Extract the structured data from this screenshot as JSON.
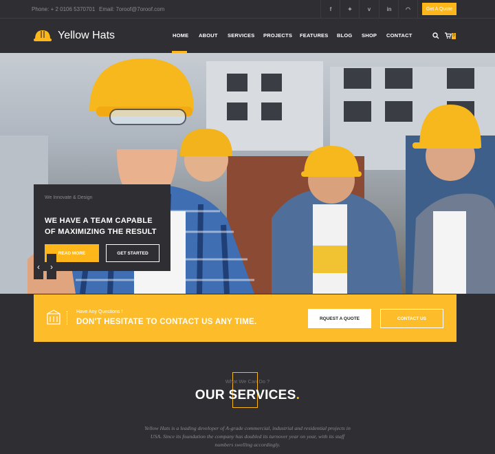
{
  "topbar": {
    "phone": "Phone: + 2 0106 5370701",
    "email": "Email: 7oroof@7oroof.com",
    "social": [
      "facebook-icon",
      "twitter-icon",
      "vimeo-icon",
      "linkedin-icon",
      "rss-icon"
    ],
    "social_glyphs": [
      "f",
      "✦",
      "v",
      "in",
      "◠"
    ],
    "quote_label": "Get A Quote"
  },
  "brand": {
    "name": "Yellow Hats",
    "accent": "#fdb71a"
  },
  "nav": {
    "items": [
      "HOME",
      "ABOUT",
      "SERVICES",
      "PROJECTS",
      "FEATURES",
      "BLOG",
      "SHOP",
      "CONTACT"
    ],
    "active": "HOME",
    "cart_count": "0"
  },
  "hero": {
    "subtitle": "We Innovate & Design",
    "headline": "WE HAVE A TEAM CAPABLE OF MAXIMIZING THE RESULT",
    "primary_button": "READ MORE",
    "secondary_button": "GET STARTED",
    "prev": "‹",
    "next": "›"
  },
  "cta": {
    "small": "Have Any Questions !",
    "big": "DON'T HESITATE TO CONTACT US ANY TIME.",
    "quote_button": "RQUEST A QUOTE",
    "contact_button": "CONTACT US"
  },
  "services": {
    "kicker": "What We Can Do ?",
    "title": "OUR SERVICES",
    "title_dot": ".",
    "description": "Yellow Hats is a leading developer of A-grade commercial, industrial and residential projects in USA. Since its foundation the company has doubled its turnover year on year, with its staff numbers swelling accordingly."
  }
}
